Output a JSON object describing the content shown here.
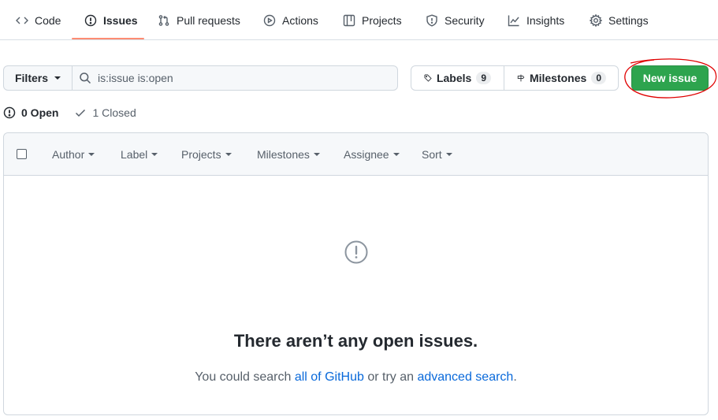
{
  "nav": {
    "tabs": [
      {
        "label": "Code",
        "icon": "code-icon"
      },
      {
        "label": "Issues",
        "icon": "issue-opened-icon",
        "active": true
      },
      {
        "label": "Pull requests",
        "icon": "git-pull-request-icon"
      },
      {
        "label": "Actions",
        "icon": "play-icon"
      },
      {
        "label": "Projects",
        "icon": "table-icon"
      },
      {
        "label": "Security",
        "icon": "shield-icon"
      },
      {
        "label": "Insights",
        "icon": "graph-icon"
      },
      {
        "label": "Settings",
        "icon": "gear-icon"
      }
    ],
    "active_underline_color": "#fd8c73"
  },
  "toolbar": {
    "filters_label": "Filters",
    "search_value": "is:issue is:open",
    "labels_label": "Labels",
    "labels_count": "9",
    "milestones_label": "Milestones",
    "milestones_count": "0",
    "new_issue_label": "New issue",
    "new_issue_color": "#2da44e",
    "annotation_color": "#e00000"
  },
  "states": {
    "open_label": "0 Open",
    "closed_label": "1 Closed"
  },
  "table_header": {
    "author": "Author",
    "label": "Label",
    "projects": "Projects",
    "milestones": "Milestones",
    "assignee": "Assignee",
    "sort": "Sort"
  },
  "blankslate": {
    "title": "There aren’t any open issues.",
    "text_before": "You could search ",
    "link1": "all of GitHub",
    "text_middle": " or try an ",
    "link2": "advanced search",
    "text_after": ".",
    "link_color": "#0969da"
  }
}
